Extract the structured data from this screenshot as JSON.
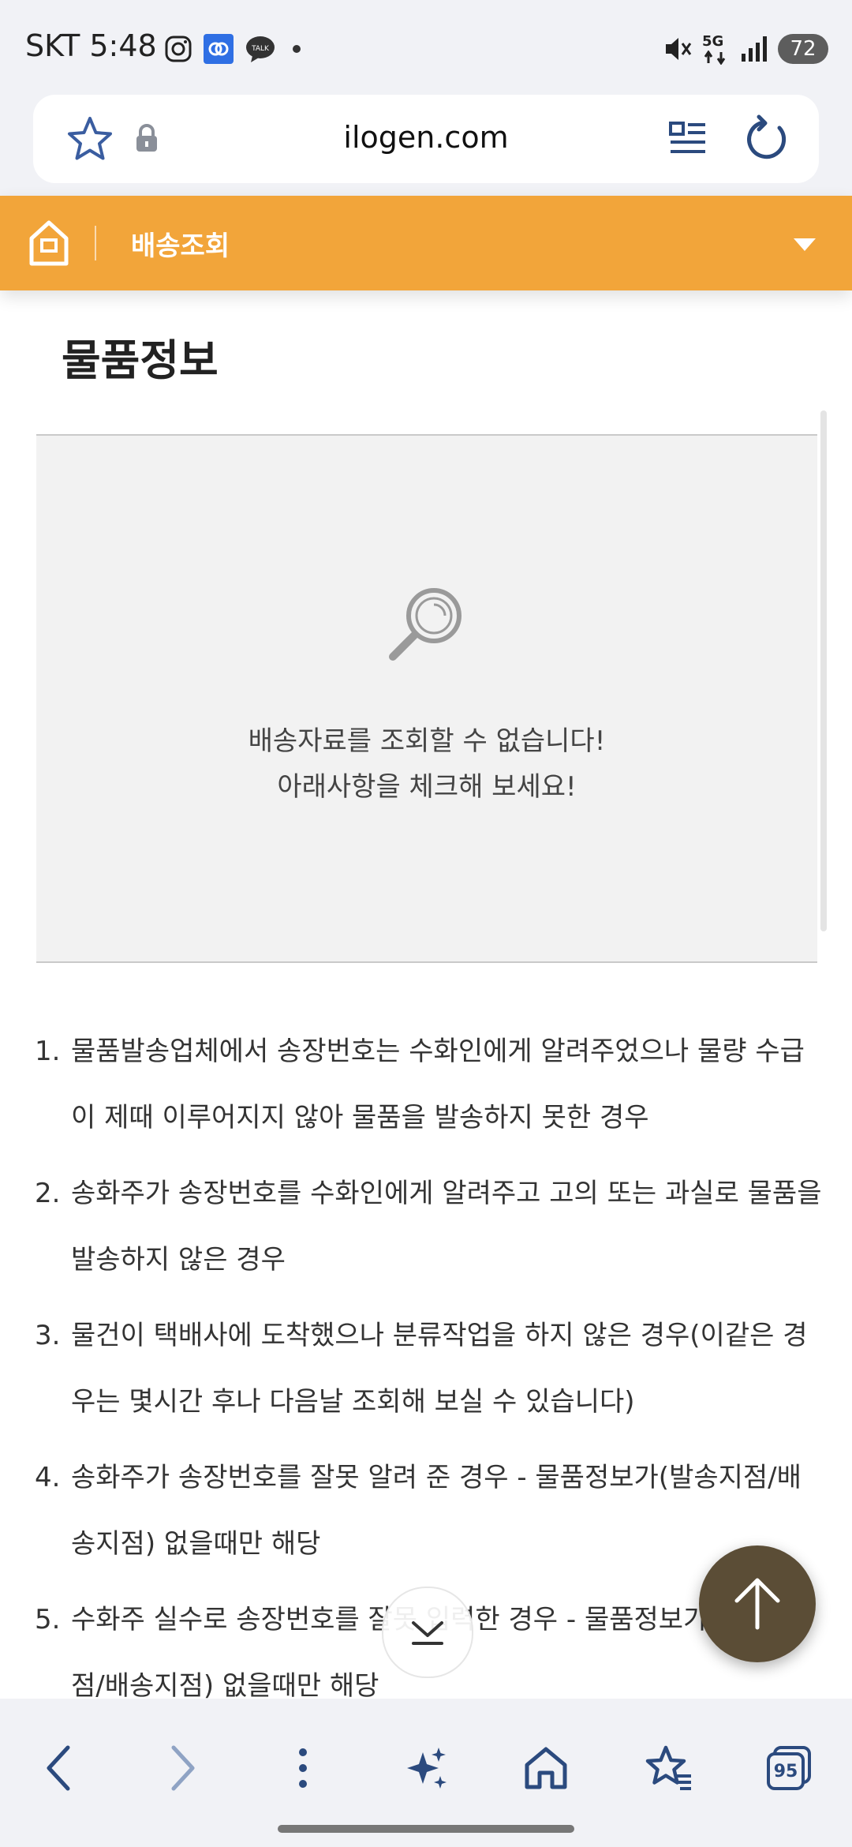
{
  "status_bar": {
    "carrier_time": "SKT 5:48",
    "network": "5G",
    "battery": "72"
  },
  "browser": {
    "url": "ilogen.com",
    "tab_count": "95"
  },
  "header": {
    "menu_title": "배송조회"
  },
  "main": {
    "page_title": "물품정보",
    "result_line1": "배송자료를 조회할 수 없습니다!",
    "result_line2": "아래사항을 체크해 보세요!",
    "notes": [
      {
        "num": "1.",
        "text": "물품발송업체에서 송장번호는 수화인에게 알려주었으나 물량 수급이 제때 이루어지지 않아 물품을 발송하지 못한 경우"
      },
      {
        "num": "2.",
        "text": "송화주가 송장번호를 수화인에게 알려주고 고의 또는 과실로 물품을 발송하지 않은 경우"
      },
      {
        "num": "3.",
        "text": "물건이 택배사에 도착했으나 분류작업을 하지 않은 경우(이같은 경우는 몇시간 후나 다음날 조회해 보실 수 있습니다)"
      },
      {
        "num": "4.",
        "text": "송화주가 송장번호를 잘못 알려 준 경우 - 물품정보가(발송지점/배송지점) 없을때만 해당"
      },
      {
        "num": "5.",
        "text": "수화주 실수로 송장번호를 잘못 입력한 경우 - 물품정보가(발송지점/배송지점) 없을때만 해당"
      }
    ]
  },
  "colors": {
    "header_orange": "#f2a53a",
    "fab_brown": "#5b4d36",
    "nav_blue": "#2b4a7e"
  }
}
